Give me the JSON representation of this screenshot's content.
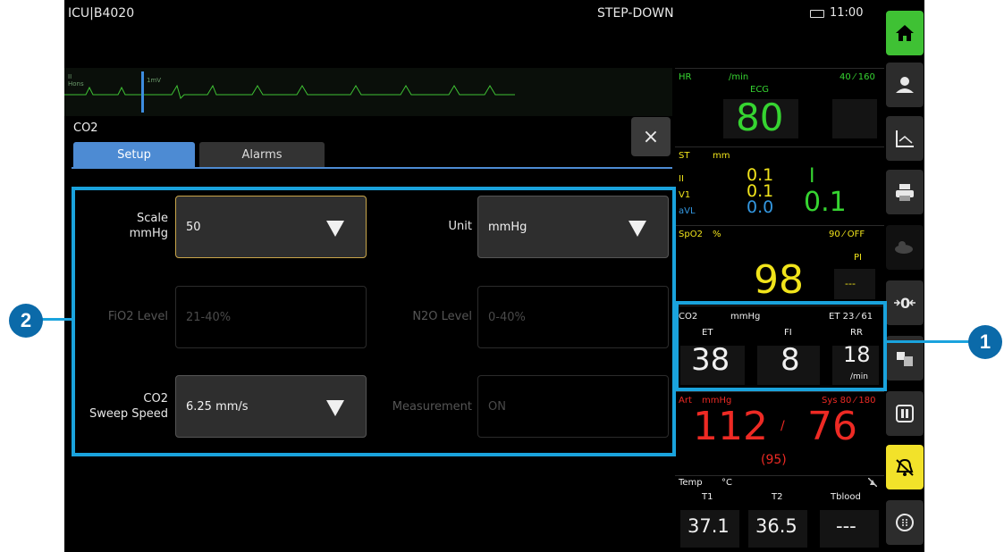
{
  "header": {
    "bed": "ICU|B4020",
    "unit": "STEP-DOWN",
    "time": "11:00"
  },
  "ecg_strip": {
    "lead": "II",
    "mode": "Hons",
    "scale": "1mV"
  },
  "panel": {
    "title": "CO2",
    "close_glyph": "×",
    "tabs": [
      {
        "label": "Setup",
        "active": true
      },
      {
        "label": "Alarms",
        "active": false
      }
    ],
    "fields": {
      "scale": {
        "label1": "Scale",
        "label2": "mmHg",
        "value": "50",
        "enabled": true
      },
      "unit": {
        "label": "Unit",
        "value": "mmHg",
        "enabled": true
      },
      "fio2": {
        "label": "FiO2 Level",
        "value": "21-40%",
        "enabled": false
      },
      "n2o": {
        "label": "N2O Level",
        "value": "0-40%",
        "enabled": false
      },
      "sweep": {
        "label1": "CO2",
        "label2": "Sweep Speed",
        "value": "6.25 mm/s",
        "enabled": true
      },
      "measurement": {
        "label": "Measurement",
        "value": "ON",
        "enabled": false
      }
    }
  },
  "vitals": {
    "hr": {
      "label": "HR",
      "unit": "/min",
      "limits": "40 ⁄ 160",
      "source": "ECG",
      "value": "80"
    },
    "st": {
      "label": "ST",
      "unit": "mm",
      "leads": [
        {
          "lead": "II",
          "value": "0.1"
        },
        {
          "lead": "V1",
          "value": "0.1"
        },
        {
          "lead": "aVL",
          "value": "0.0"
        }
      ],
      "big_lead": "I",
      "big_value": "0.1"
    },
    "spo2": {
      "label": "SpO2",
      "unit": "%",
      "limits": "90 ⁄ OFF",
      "pi_label": "PI",
      "pi_value": "---",
      "value": "98"
    },
    "co2": {
      "label": "CO2",
      "unit": "mmHg",
      "limits": "ET 23 ⁄ 61",
      "et_label": "ET",
      "fi_label": "FI",
      "rr_label": "RR",
      "et": "38",
      "fi": "8",
      "rr": "18",
      "rr_unit": "/min"
    },
    "art": {
      "label": "Art",
      "unit": "mmHg",
      "limits": "Sys 80 ⁄ 180",
      "sys": "112",
      "sep": "/",
      "dia": "76",
      "mean": "(95)"
    },
    "temp": {
      "label": "Temp",
      "unit": "°C",
      "t1_label": "T1",
      "t2_label": "T2",
      "tb_label": "Tblood",
      "t1": "37.1",
      "t2": "36.5",
      "tb": "---"
    }
  },
  "sidebar": {
    "buttons": [
      "home-icon",
      "patient-icon",
      "trends-icon",
      "printer-icon",
      "nibp-icon",
      "zero-icon",
      "procedures-icon",
      "pause-icon",
      "alarm-silence-icon",
      "menu-icon"
    ]
  },
  "callouts": {
    "one": "1",
    "two": "2"
  },
  "colors": {
    "accent_blue": "#1aa3dd",
    "hr_green": "#36d431",
    "spo2_yellow": "#f1e41b",
    "art_red": "#ee2a24",
    "tab_blue": "#4d8bd3"
  }
}
